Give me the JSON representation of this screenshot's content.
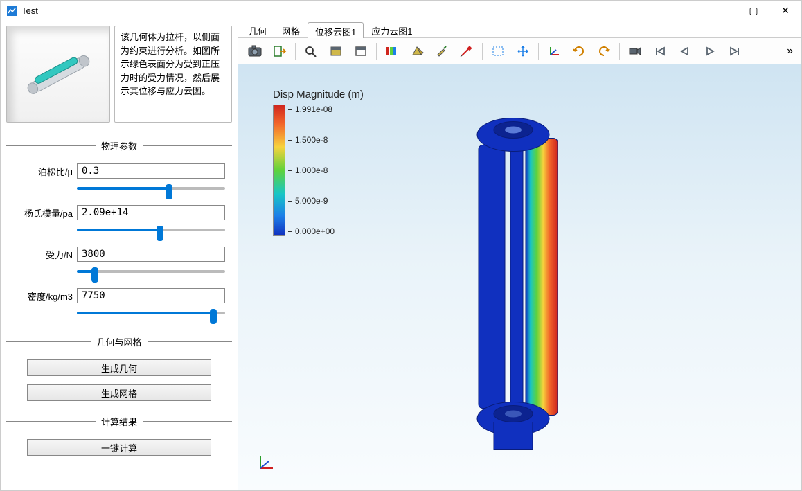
{
  "window": {
    "title": "Test"
  },
  "description_text": "该几何体为拉杆，以侧面为约束进行分析。如图所示绿色表面分为受到正压力时的受力情况，然后展示其位移与应力云图。",
  "sections": {
    "physical_params": "物理参数",
    "geometry_mesh": "几何与网格",
    "calc_result": "计算结果"
  },
  "params": {
    "poisson": {
      "label": "泊松比/μ",
      "value": "0.3",
      "slider_pct": 62
    },
    "young": {
      "label": "杨氏模量/pa",
      "value": "2.09e+14",
      "slider_pct": 56
    },
    "force": {
      "label": "受力/N",
      "value": "3800",
      "slider_pct": 12
    },
    "density": {
      "label": "密度/kg/m3",
      "value": "7750",
      "slider_pct": 92
    }
  },
  "buttons": {
    "gen_geom": "生成几何",
    "gen_mesh": "生成网格",
    "one_click": "一键计算"
  },
  "tabs": [
    {
      "label": "几何",
      "active": false
    },
    {
      "label": "网格",
      "active": false
    },
    {
      "label": "位移云图1",
      "active": true
    },
    {
      "label": "应力云图1",
      "active": false
    }
  ],
  "legend": {
    "title": "Disp Magnitude (m)",
    "ticks": [
      "1.991e-08",
      "1.500e-8",
      "1.000e-8",
      "5.000e-9",
      "0.000e+00"
    ]
  },
  "toolbar_icons": [
    "camera-icon",
    "export-icon",
    "zoom-icon",
    "toggle-box-icon",
    "toggle-box2-icon",
    "palette-icon",
    "shading-icon",
    "paint-icon",
    "dropper-icon",
    "select-box-icon",
    "move-icon",
    "axes-icon",
    "rotate-cw-icon",
    "rotate-ccw-icon",
    "video-icon",
    "first-frame-icon",
    "prev-frame-icon",
    "next-frame-icon",
    "last-frame-icon"
  ]
}
